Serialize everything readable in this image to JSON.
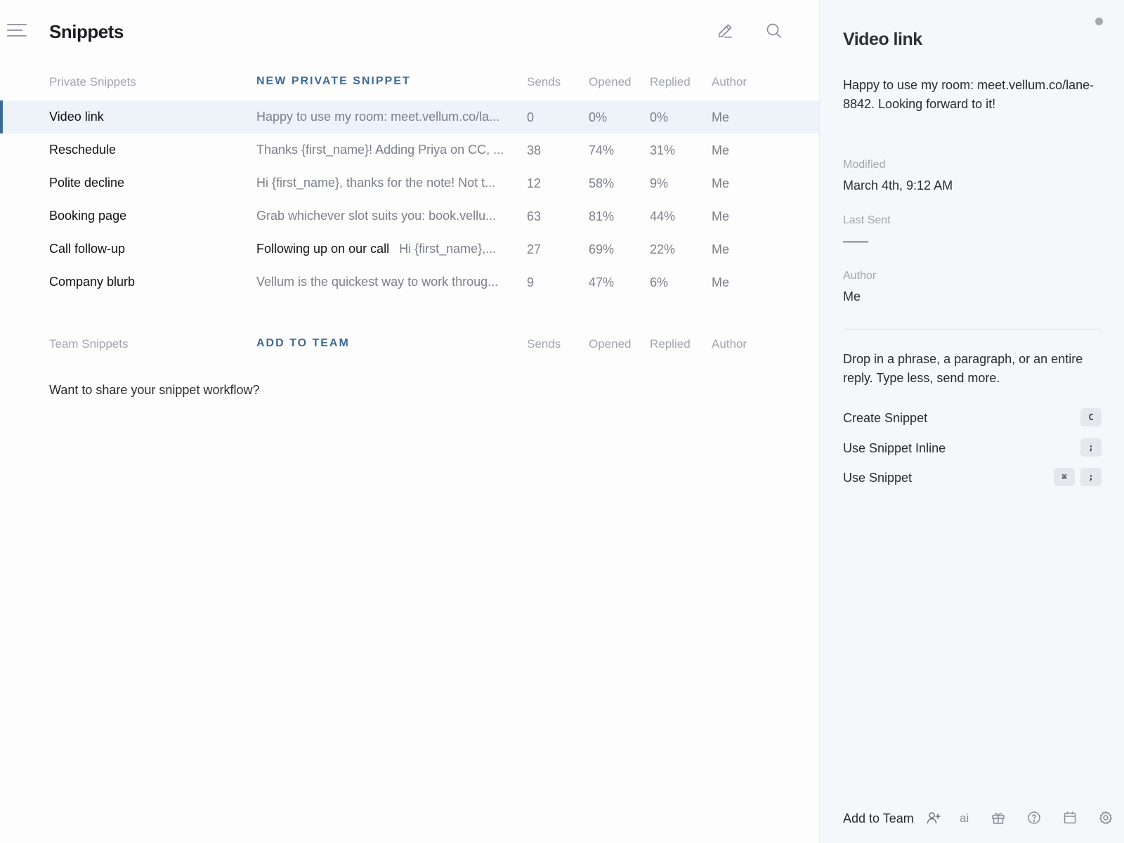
{
  "header": {
    "title": "Snippets",
    "menu_icon": "hamburger-menu-icon",
    "compose_icon": "pencil-icon",
    "search_icon": "search-icon"
  },
  "private_section": {
    "label": "Private Snippets",
    "action": "NEW PRIVATE SNIPPET",
    "columns": [
      "Sends",
      "Opened",
      "Replied",
      "Author"
    ]
  },
  "snippets": [
    {
      "name": "Video link",
      "subject": "",
      "preview": "Happy to use my room: meet.vellum.co/la...",
      "sends": "0",
      "opened": "0%",
      "replied": "0%",
      "author": "Me",
      "selected": true
    },
    {
      "name": "Reschedule",
      "subject": "",
      "preview": "Thanks {first_name}! Adding Priya on CC, ...",
      "sends": "38",
      "opened": "74%",
      "replied": "31%",
      "author": "Me"
    },
    {
      "name": "Polite decline",
      "subject": "",
      "preview": "Hi {first_name}, thanks for the note! Not t...",
      "sends": "12",
      "opened": "58%",
      "replied": "9%",
      "author": "Me"
    },
    {
      "name": "Booking page",
      "subject": "",
      "preview": "Grab whichever slot suits you: book.vellu...",
      "sends": "63",
      "opened": "81%",
      "replied": "44%",
      "author": "Me"
    },
    {
      "name": "Call follow-up",
      "subject": "Following up on our call",
      "preview": "Hi {first_name},...",
      "sends": "27",
      "opened": "69%",
      "replied": "22%",
      "author": "Me"
    },
    {
      "name": "Company blurb",
      "subject": "",
      "preview": "Vellum is the quickest way to work throug...",
      "sends": "9",
      "opened": "47%",
      "replied": "6%",
      "author": "Me"
    }
  ],
  "team_section": {
    "label": "Team Snippets",
    "action": "ADD TO TEAM",
    "columns": [
      "Sends",
      "Opened",
      "Replied",
      "Author"
    ],
    "empty_text": "Want to share your snippet workflow?"
  },
  "detail": {
    "title": "Video link",
    "body": "Happy to use my room: meet.vellum.co/lane-8842. Looking forward to it!",
    "modified_label": "Modified",
    "modified_value": "March 4th, 9:12 AM",
    "last_sent_label": "Last Sent",
    "last_sent_value": "——",
    "author_label": "Author",
    "author_value": "Me",
    "description": "Drop in a phrase, a paragraph, or an entire reply. Type less, send more.",
    "shortcuts": [
      {
        "label": "Create Snippet",
        "keys": [
          "C"
        ]
      },
      {
        "label": "Use Snippet Inline",
        "keys": [
          ";"
        ]
      },
      {
        "label": "Use Snippet",
        "keys": [
          "⌘",
          ";"
        ]
      }
    ]
  },
  "footer": {
    "add_team": "Add to Team",
    "ai": "ai",
    "icons": [
      "add-user-icon",
      "gift-icon",
      "help-icon",
      "calendar-icon",
      "gear-icon"
    ]
  },
  "colors": {
    "accent": "#3d6b98",
    "selected_row": "#eef2f9",
    "side_bg": "#f6f7fb"
  }
}
